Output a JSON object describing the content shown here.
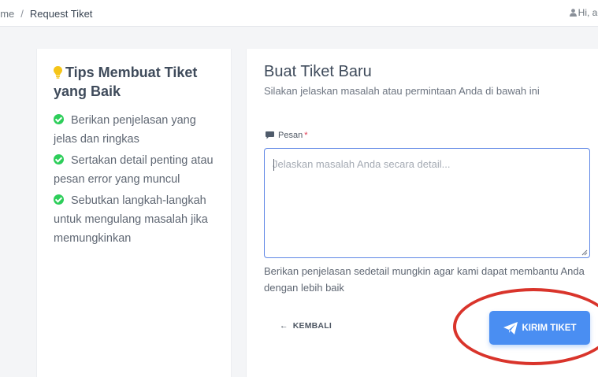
{
  "breadcrumb": {
    "home": "ome",
    "separator": "/",
    "current": "Request Tiket"
  },
  "user": {
    "greeting": "Hi, adr",
    "icon": "user-icon"
  },
  "tips": {
    "icon": "lightbulb-icon",
    "title": "Tips Membuat Tiket yang Baik",
    "items": [
      "Berikan penjelasan yang jelas dan ringkas",
      "Sertakan detail penting atau pesan error yang muncul",
      "Sebutkan langkah-langkah untuk mengulang masalah jika memungkinkan"
    ]
  },
  "form": {
    "title": "Buat Tiket Baru",
    "subtitle": "Silakan jelaskan masalah atau permintaan Anda di bawah ini",
    "message_label": "Pesan",
    "required_mark": "*",
    "message_placeholder": "Jelaskan masalah Anda secara detail...",
    "help_text": "Berikan penjelasan sedetail mungkin agar kami dapat membantu Anda dengan lebih baik",
    "back_label": "KEMBALI",
    "submit_label": "KIRIM TIKET"
  },
  "colors": {
    "accent": "#4a8ef2",
    "check": "#2dce5a",
    "lightbulb": "#f5c518",
    "annotation": "#d9342b"
  }
}
